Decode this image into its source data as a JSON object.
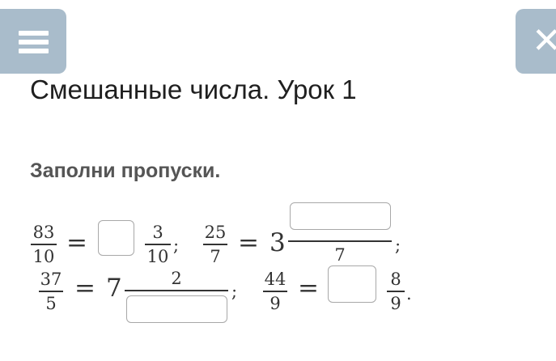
{
  "header": {
    "title": "Смешанные числа. Урок 1",
    "instruction": "Заполни пропуски."
  },
  "buttons": {
    "menu_icon": "hamburger-icon",
    "close_icon": "close-icon",
    "close_glyph": "✕",
    "accent_color": "#a9bccb"
  },
  "row1": {
    "eq1": {
      "num": "83",
      "den": "10",
      "eq": "=",
      "frac_num": "3",
      "frac_den": "10",
      "sep": ";"
    },
    "eq2": {
      "num": "25",
      "den": "7",
      "eq": "=",
      "whole": "3",
      "den_shown": "7",
      "sep": ";"
    }
  },
  "row2": {
    "eq3": {
      "num": "37",
      "den": "5",
      "eq": "=",
      "whole": "7",
      "num_shown": "2",
      "sep": ";"
    },
    "eq4": {
      "num": "44",
      "den": "9",
      "eq": "=",
      "frac_num": "8",
      "frac_den": "9",
      "end": "."
    }
  }
}
